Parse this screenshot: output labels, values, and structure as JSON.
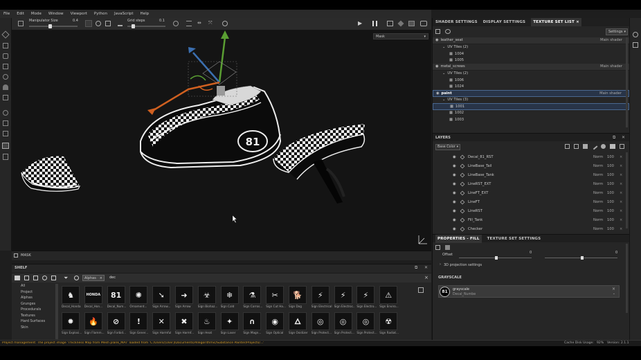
{
  "menu": [
    "File",
    "Edit",
    "Mode",
    "Window",
    "Viewport",
    "Python",
    "JavaScript",
    "Help"
  ],
  "toolbar": {
    "manipulator_label": "Manipulator Size",
    "manipulator_value": "0.4",
    "grid_label": "Grid steps",
    "grid_value": "0.1"
  },
  "viewport": {
    "mode_select": "Mask",
    "footer_label": "MASK",
    "decal_number": "81"
  },
  "right_tabs": [
    "SHADER SETTINGS",
    "DISPLAY SETTINGS",
    "TEXTURE SET LIST"
  ],
  "settings_button": "Settings",
  "texture_sets": [
    {
      "name": "leather_seat",
      "shader": "Main shader",
      "uv": "UV Tiles (2)",
      "tiles": [
        "1004",
        "1005"
      ]
    },
    {
      "name": "metal_screws",
      "shader": "Main shader",
      "uv": "UV Tiles (2)",
      "tiles": [
        "1006",
        "1024"
      ]
    },
    {
      "name": "paint",
      "shader": "Main shader",
      "uv": "UV Tiles (3)",
      "tiles": [
        "1001",
        "1002",
        "1003"
      ]
    }
  ],
  "layers_panel": {
    "title": "LAYERS",
    "channel_select": "Base Color",
    "layers": [
      {
        "name": "Decal_81_RST",
        "blend": "Norm",
        "opacity": "100"
      },
      {
        "name": "LineBase_Tail",
        "blend": "Norm",
        "opacity": "100"
      },
      {
        "name": "LineBase_Tank",
        "blend": "Norm",
        "opacity": "100"
      },
      {
        "name": "LineRST_EXT",
        "blend": "Norm",
        "opacity": "100"
      },
      {
        "name": "LineFT_EXT",
        "blend": "Norm",
        "opacity": "100"
      },
      {
        "name": "LineFT",
        "blend": "Norm",
        "opacity": "100"
      },
      {
        "name": "LineRST",
        "blend": "Norm",
        "opacity": "100"
      },
      {
        "name": "Fill_Tank",
        "blend": "Norm",
        "opacity": "100"
      },
      {
        "name": "Checker",
        "blend": "Norm",
        "opacity": "100"
      }
    ]
  },
  "properties_tabs": [
    "PROPERTIES - FILL",
    "TEXTURE SET SETTINGS"
  ],
  "properties": {
    "offset_label": "Offset",
    "offset_value_1": "0",
    "offset_value_2": "0",
    "projection_label": "3D projection settings",
    "grayscale_header": "GRAYSCALE",
    "grayscale_name": "grayscale",
    "grayscale_source": "Decal_Numbe"
  },
  "shelf": {
    "title": "SHELF",
    "filter_tag": "Alphas",
    "search_text": "dec",
    "categories": [
      "All",
      "Project",
      "Alphas",
      "Grunges",
      "Procedurals",
      "Textures",
      "Hard Surfaces",
      "Skin"
    ],
    "items_row1": [
      "Decal_Honda",
      "Decal_Hon...",
      "Decal_Num...",
      "Ornament...",
      "Sign Arrow...",
      "Sign Arrow",
      "Sign Biohaz...",
      "Sign Cold",
      "Sign Corros...",
      "Sign Cut Ha...",
      "Sign Dog",
      "Sign Electrical",
      "Sign Electroc...",
      "Sign Electro...",
      "Sign Enviro..."
    ],
    "items_row2": [
      "Sign Explosi...",
      "Sign Flamm...",
      "Sign Forbid...",
      "Sign Gener...",
      "Sign Harmful",
      "Sign Harmf...",
      "Sign Heat",
      "Sign Laser",
      "Sign Magn...",
      "Sign Optical",
      "Sign Oxidizer",
      "Sign Protect...",
      "Sign Protect...",
      "Sign Protect...",
      "Sign Radiat..."
    ]
  },
  "status": {
    "message": "Project management: The project image 'Thickness Map from Mesh plank_MAT' loaded from 'C:/Users/[User]/Documents/Allegorithmic/Substance Painter/Projects/...'",
    "cache": "Cache Disk Usage:",
    "cache_value": "92%",
    "version": "Version: 2.1.1"
  }
}
